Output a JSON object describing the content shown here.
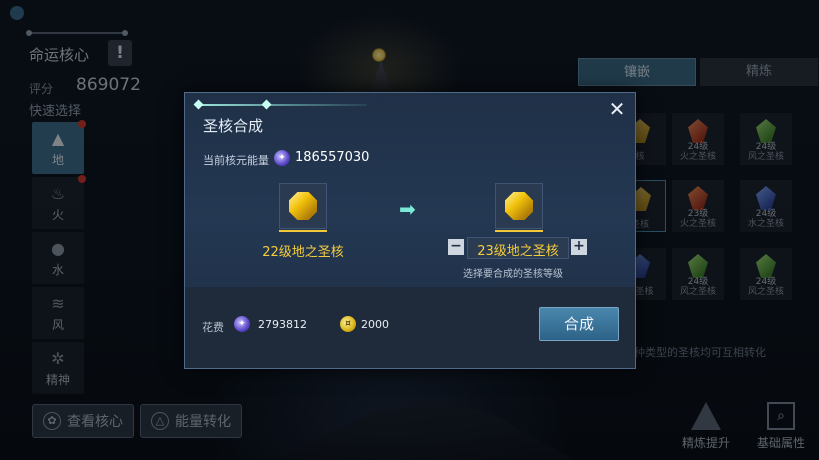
{
  "left_panel": {
    "title": "命运核心",
    "warn_icon": "!",
    "score_label": "评分",
    "score_value": "869072",
    "quick_select_label": "快速选择",
    "elements": [
      {
        "label": "地",
        "icon": "mountain-icon",
        "active": true,
        "dot": true
      },
      {
        "label": "火",
        "icon": "flame-icon",
        "active": false,
        "dot": true
      },
      {
        "label": "水",
        "icon": "drop-icon",
        "active": false,
        "dot": false
      },
      {
        "label": "风",
        "icon": "wind-icon",
        "active": false,
        "dot": false
      },
      {
        "label": "精神",
        "icon": "spirit-icon",
        "active": false,
        "dot": false
      }
    ],
    "view_core_button": "查看核心",
    "energy_convert_button": "能量转化"
  },
  "right_panel": {
    "tabs": [
      {
        "label": "镶嵌",
        "active": true
      },
      {
        "label": "精炼",
        "active": false
      }
    ],
    "cells": [
      {
        "level": "",
        "name": "核"
      },
      {
        "level": "24级",
        "name": "火之圣核"
      },
      {
        "level": "24级",
        "name": "风之圣核"
      },
      {
        "level": "",
        "name": "圣核"
      },
      {
        "level": "23级",
        "name": "火之圣核"
      },
      {
        "level": "24级",
        "name": "水之圣核"
      },
      {
        "level": "",
        "name": "之圣核"
      },
      {
        "level": "24级",
        "name": "风之圣核"
      },
      {
        "level": "24级",
        "name": "风之圣核"
      }
    ],
    "hint": "种类型的圣核均可互相转化",
    "refine_up_label": "精炼提升",
    "base_attr_label": "基础属性"
  },
  "modal": {
    "title": "圣核合成",
    "energy_label": "当前核元能量",
    "energy_value": "186557030",
    "source_core": "22级地之圣核",
    "target_core": "23级地之圣核",
    "minus": "−",
    "plus": "+",
    "select_hint": "选择要合成的圣核等级",
    "cost_label": "花费",
    "cost_energy": "2793812",
    "cost_coin": "2000",
    "synthesize_button": "合成",
    "close": "✕"
  },
  "colors": {
    "accent": "#3c6f8f",
    "gold_text": "#f5cd3c",
    "modal_bg": "#243853"
  }
}
